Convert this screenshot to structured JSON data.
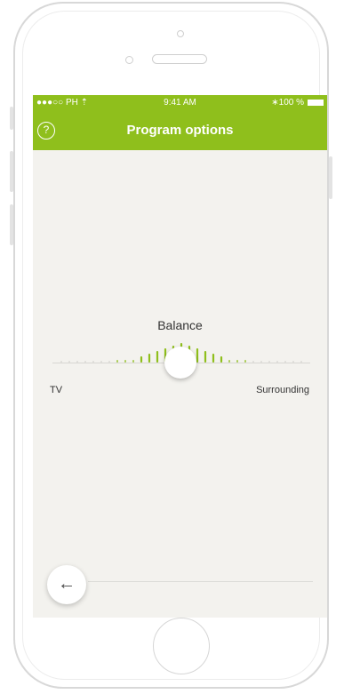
{
  "status_bar": {
    "carrier": "●●●○○ PH ⇡",
    "time": "9:41 AM",
    "battery": "∗100 %"
  },
  "header": {
    "help_icon": "?",
    "title": "Program options"
  },
  "balance": {
    "label": "Balance",
    "left_label": "TV",
    "right_label": "Surrounding",
    "value": 0.5
  },
  "back_button": {
    "icon": "←"
  },
  "colors": {
    "accent": "#8fbf1c",
    "screen_bg": "#f3f2ee"
  }
}
